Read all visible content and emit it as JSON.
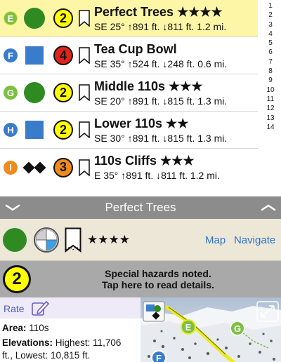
{
  "runs": [
    {
      "letter": "E",
      "letter_color": "#7bc043",
      "difficulty": "green-circle",
      "hazard": "2",
      "hazard_color": "#ffff00",
      "name": "Perfect Trees ★★★★",
      "detail": "SE 25° ↑891 ft. ↓811 ft. 1.2 mi.",
      "selected": true
    },
    {
      "letter": "F",
      "letter_color": "#3a7ccc",
      "difficulty": "blue-square",
      "hazard": "4",
      "hazard_color": "#e0241b",
      "name": "Tea Cup Bowl",
      "detail": "SE 35° ↑524 ft. ↓248 ft. 0.6 mi.",
      "selected": false
    },
    {
      "letter": "G",
      "letter_color": "#7bc043",
      "difficulty": "green-circle",
      "hazard": "2",
      "hazard_color": "#ffff00",
      "name": "Middle 110s ★★★",
      "detail": "SE 20° ↑891 ft. ↓815 ft. 1.3 mi.",
      "selected": false
    },
    {
      "letter": "H",
      "letter_color": "#3a7ccc",
      "difficulty": "blue-square",
      "hazard": "2",
      "hazard_color": "#ffff00",
      "name": "Lower 110s ★★",
      "detail": "SE 30° ↑891 ft. ↓815 ft. 1.3 mi.",
      "selected": false
    },
    {
      "letter": "I",
      "letter_color": "#ef8a1f",
      "difficulty": "double-black-diamond",
      "hazard": "3",
      "hazard_color": "#ef8a1f",
      "name": "110s Cliffs ★★★",
      "detail": "E 35° ↑891 ft. ↓811 ft. 1.2 mi.",
      "selected": false
    }
  ],
  "index": [
    "1",
    "2",
    "3",
    "4",
    "5",
    "6",
    "7",
    "8",
    "9",
    "10",
    "11",
    "12",
    "13",
    "14"
  ],
  "detail": {
    "title": "Perfect Trees",
    "stars": "★★★★",
    "map_link": "Map",
    "navigate_link": "Navigate",
    "hazard_number": "2",
    "hazard_line1": "Special hazards noted.",
    "hazard_line2": "Tap here to read details.",
    "rate_label": "Rate",
    "area_label": "Area:",
    "area_value": "110s",
    "elev_label": "Elevations:",
    "elev_value1": "Highest: 11,706",
    "elev_value2": "ft., Lowest: 10,815 ft.",
    "map_markers": [
      "E",
      "G",
      "F"
    ]
  },
  "colors": {
    "selected_row": "#fdf6a6",
    "header_bar": "#8c8c8c",
    "link": "#2f74c8",
    "green_run": "#2f8a22",
    "blue_run": "#3a7ccc",
    "track": "#e9ec1a"
  }
}
